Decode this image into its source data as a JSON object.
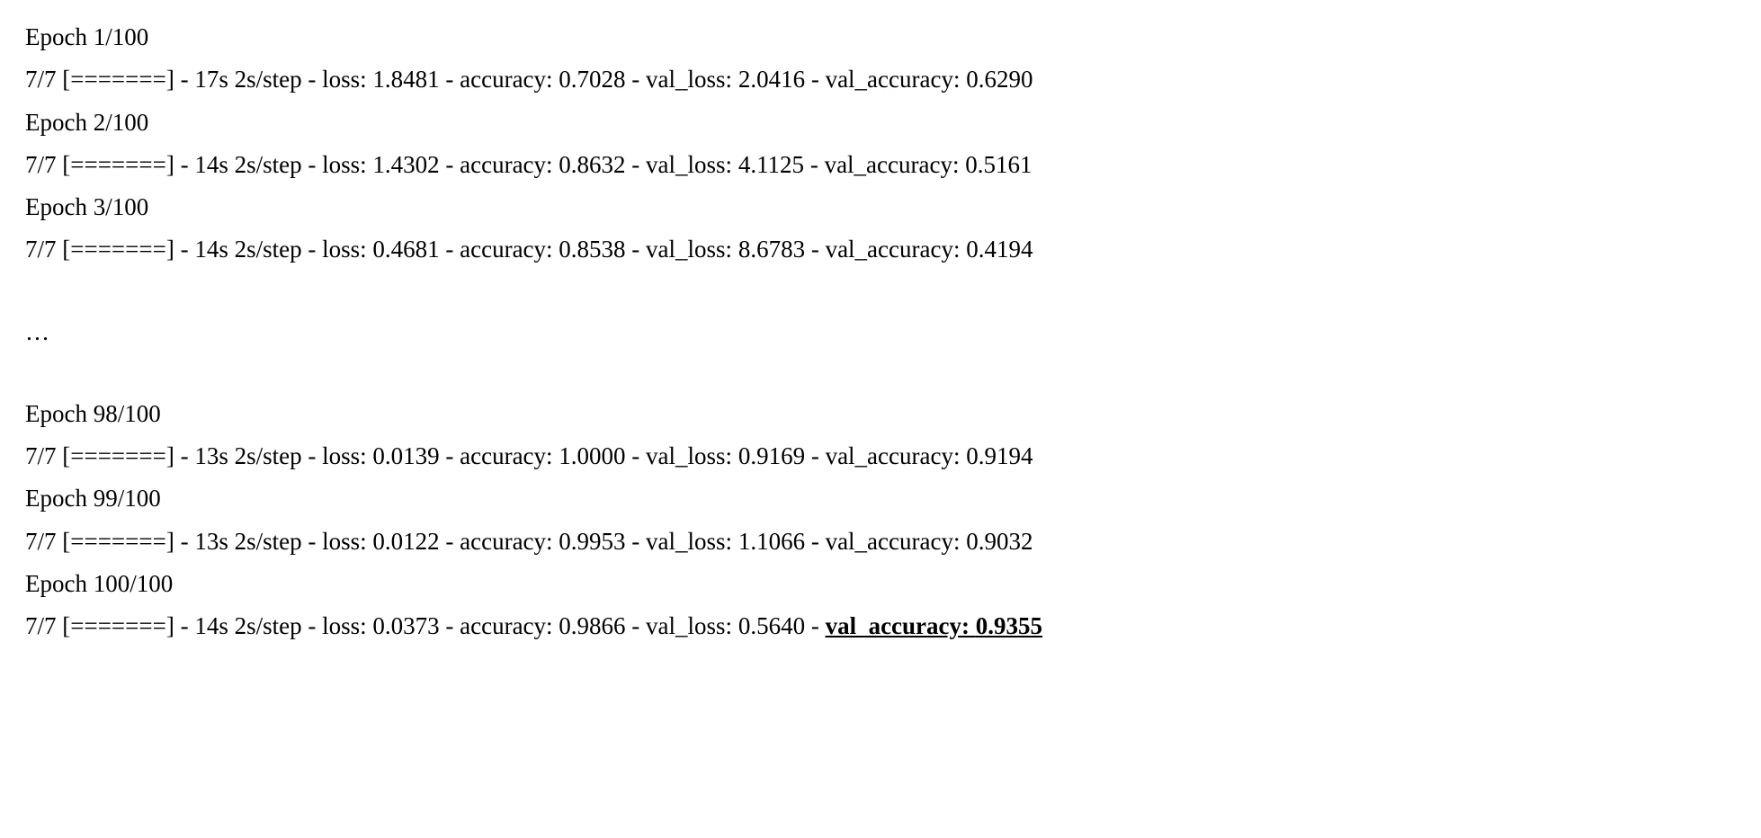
{
  "epochs": [
    {
      "header": "Epoch 1/100",
      "progress": "7/7 [=======]",
      "time": "17s 2s/step",
      "loss": "1.8481",
      "accuracy": "0.7028",
      "val_loss": "2.0416",
      "val_accuracy": "0.6290"
    },
    {
      "header": "Epoch 2/100",
      "progress": "7/7 [=======]",
      "time": "14s 2s/step",
      "loss": "1.4302",
      "accuracy": "0.8632",
      "val_loss": "4.1125",
      "val_accuracy": "0.5161"
    },
    {
      "header": "Epoch 3/100",
      "progress": "7/7 [=======]",
      "time": "14s 2s/step",
      "loss": "0.4681",
      "accuracy": "0.8538",
      "val_loss": "8.6783",
      "val_accuracy": "0.4194"
    }
  ],
  "ellipsis": "…",
  "epochs_tail": [
    {
      "header": "Epoch 98/100",
      "progress": "7/7 [=======]",
      "time": "13s 2s/step",
      "loss": "0.0139",
      "accuracy": "1.0000",
      "val_loss": "0.9169",
      "val_accuracy": "0.9194"
    },
    {
      "header": "Epoch 99/100",
      "progress": "7/7 [=======]",
      "time": "13s 2s/step",
      "loss": "0.0122",
      "accuracy": "0.9953",
      "val_loss": "1.1066",
      "val_accuracy": "0.9032"
    },
    {
      "header": "Epoch 100/100",
      "progress": "7/7 [=======]",
      "time": "14s 2s/step",
      "loss": "0.0373",
      "accuracy": "0.9866",
      "val_loss": "0.5640",
      "val_accuracy": "0.9355",
      "highlight_val_accuracy": true
    }
  ],
  "labels": {
    "loss": "loss:",
    "accuracy": "accuracy:",
    "val_loss": "val_loss:",
    "val_accuracy": "val_accuracy:",
    "sep": " - "
  }
}
